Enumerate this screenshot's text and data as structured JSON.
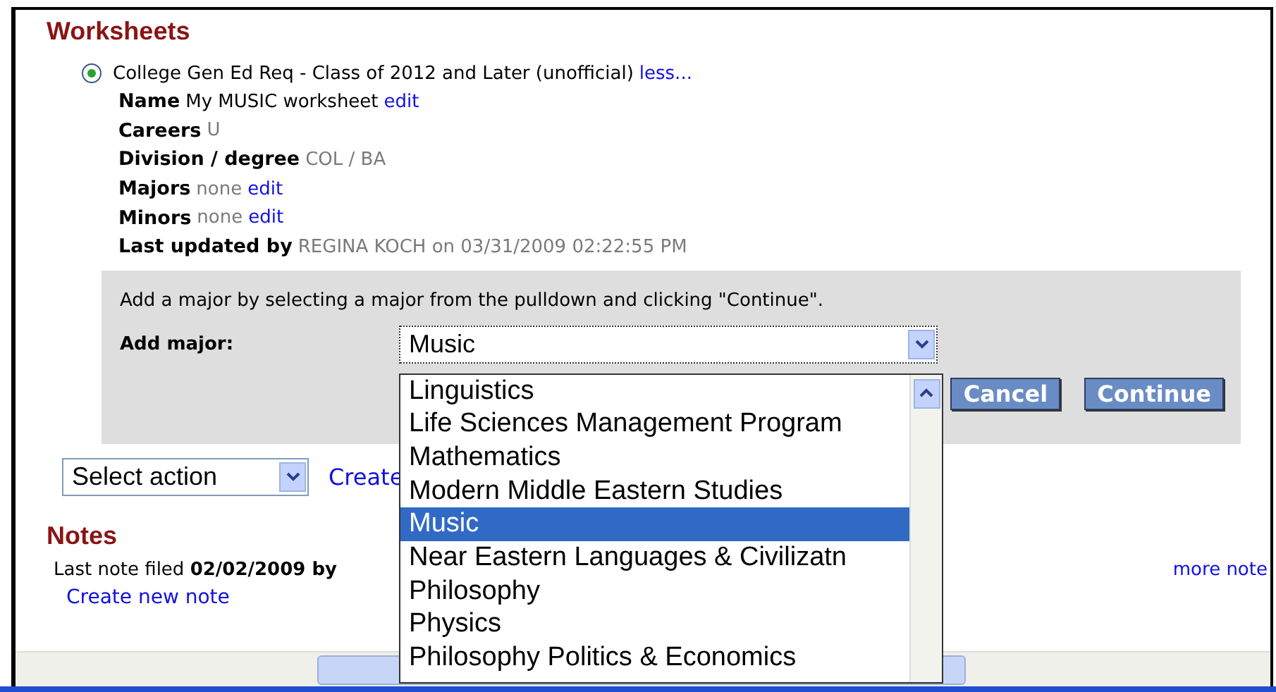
{
  "section_title": "Worksheets",
  "worksheet": {
    "selected": true,
    "title": "College Gen Ed Req - Class of 2012 and Later (unofficial)",
    "toggle_link": "less...",
    "details": [
      {
        "label": "Name",
        "value": "My MUSIC worksheet",
        "kind": "plain",
        "link": "edit"
      },
      {
        "label": "Careers",
        "value": "U",
        "kind": "muted"
      },
      {
        "label": "Division / degree",
        "value": "COL / BA",
        "kind": "muted"
      },
      {
        "label": "Majors",
        "value": "none",
        "kind": "muted",
        "link": "edit"
      },
      {
        "label": "Minors",
        "value": "none",
        "kind": "muted",
        "link": "edit"
      },
      {
        "label": "Last updated by",
        "value": "REGINA KOCH on 03/31/2009 02:22:55 PM",
        "kind": "muted"
      }
    ]
  },
  "add_major": {
    "instruction": "Add a major by selecting a major from the pulldown and clicking \"Continue\".",
    "label": "Add major:",
    "select_value": "Music",
    "options": [
      {
        "label": "Linguistics",
        "selected": false
      },
      {
        "label": "Life Sciences Management Program",
        "selected": false
      },
      {
        "label": "Mathematics",
        "selected": false
      },
      {
        "label": "Modern Middle Eastern Studies",
        "selected": false
      },
      {
        "label": "Music",
        "selected": true
      },
      {
        "label": "Near Eastern Languages & Civilizatn",
        "selected": false
      },
      {
        "label": "Philosophy",
        "selected": false
      },
      {
        "label": "Physics",
        "selected": false
      },
      {
        "label": "Philosophy Politics & Economics",
        "selected": false
      }
    ],
    "buttons": [
      "Cancel",
      "Continue"
    ]
  },
  "action_select": "Select action",
  "action_link": "Create",
  "notes": {
    "title": "Notes",
    "last_note": "Last note filed **02/02/2009 by**",
    "more_link": "more note",
    "create_link": "Create new note"
  }
}
